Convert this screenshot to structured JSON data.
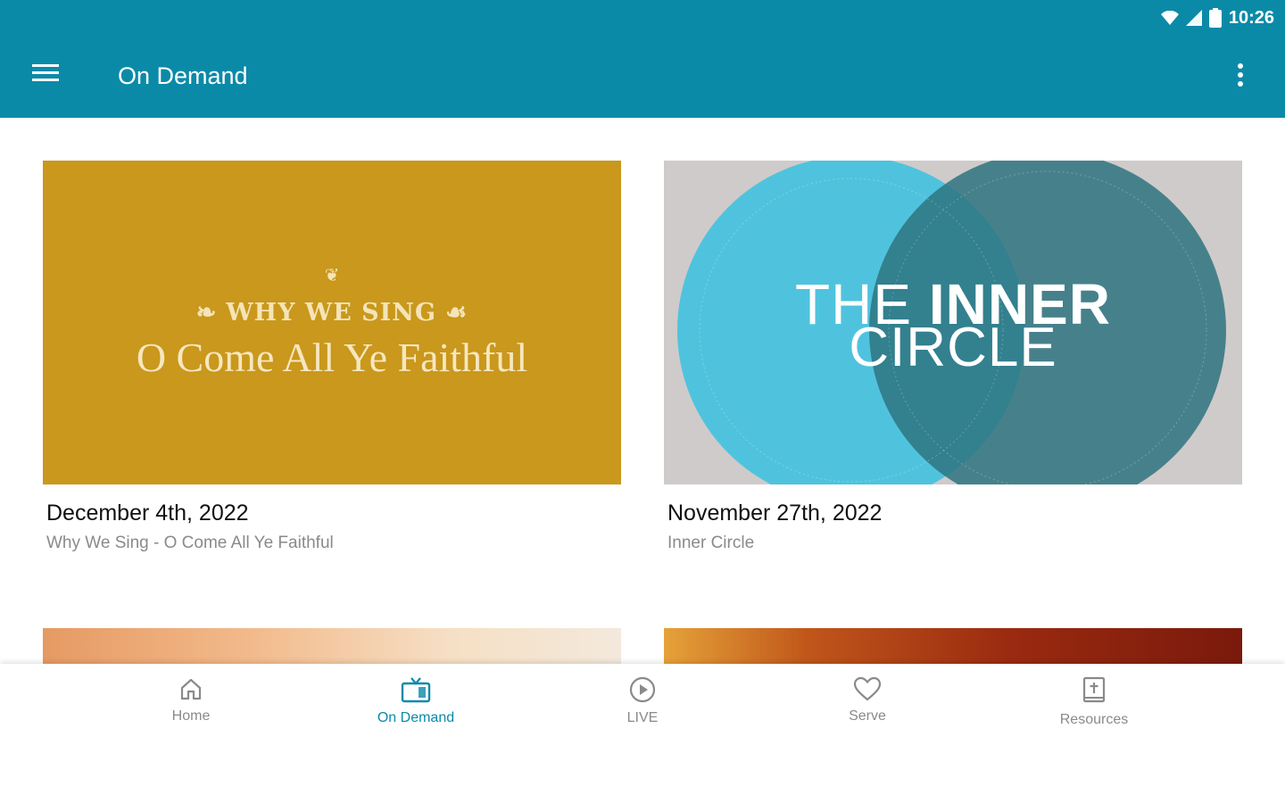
{
  "status_bar": {
    "time": "10:26"
  },
  "appbar": {
    "title": "On Demand"
  },
  "cards": [
    {
      "date": "December 4th, 2022",
      "subtitle": "Why We Sing - O Come All Ye Faithful",
      "art_kicker": "WHY WE SING",
      "art_title": "O Come All Ye Faithful",
      "art_color": "#c9981c"
    },
    {
      "date": "November 27th, 2022",
      "subtitle": "Inner Circle",
      "art_title_line1_light": "THE",
      "art_title_line1_bold": "INNER",
      "art_title_line2": "CIRCLE",
      "art_colors": [
        "#4fc3de",
        "#2e7480",
        "#cfcbca"
      ]
    }
  ],
  "bottom_nav": {
    "items": [
      {
        "label": "Home",
        "icon": "home-icon",
        "active": false
      },
      {
        "label": "On Demand",
        "icon": "tv-icon",
        "active": true
      },
      {
        "label": "LIVE",
        "icon": "play-circle-icon",
        "active": false
      },
      {
        "label": "Serve",
        "icon": "heart-icon",
        "active": false
      },
      {
        "label": "Resources",
        "icon": "bible-icon",
        "active": false
      }
    ]
  },
  "colors": {
    "primary": "#0b8aa8",
    "text_secondary": "#8a8a8a"
  }
}
